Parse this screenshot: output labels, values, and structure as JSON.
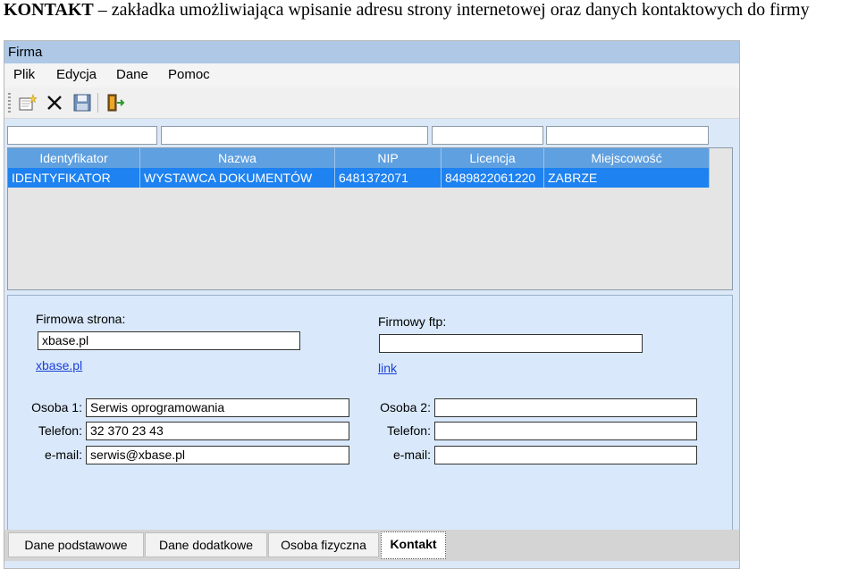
{
  "caption": {
    "bold": "KONTAKT",
    "rest": " – zakładka umożliwiająca wpisanie adresu strony internetowej oraz danych kontaktowych do firmy"
  },
  "window": {
    "title": "Firma"
  },
  "menu": [
    "Plik",
    "Edycja",
    "Dane",
    "Pomoc"
  ],
  "toolbar": {
    "icons": [
      "new-record-icon",
      "delete-icon",
      "save-icon",
      "exit-door-icon"
    ]
  },
  "grid": {
    "columns": [
      "Identyfikator",
      "Nazwa",
      "NIP",
      "Licencja",
      "Miejscowość"
    ],
    "rows": [
      [
        "IDENTYFIKATOR",
        "WYSTAWCA DOKUMENTÓW",
        "6481372071",
        "8489822061220",
        "ZABRZE"
      ]
    ]
  },
  "contact": {
    "website_label": "Firmowa strona:",
    "website_value": "xbase.pl",
    "website_link": "xbase.pl",
    "ftp_label": "Firmowy ftp:",
    "ftp_value": "",
    "ftp_link": "link",
    "person1_label": "Osoba 1:",
    "person1_value": "Serwis oprogramowania",
    "phone1_label": "Telefon:",
    "phone1_value": "32 370 23 43",
    "email1_label": "e-mail:",
    "email1_value": "serwis@xbase.pl",
    "person2_label": "Osoba 2:",
    "person2_value": "",
    "phone2_label": "Telefon:",
    "phone2_value": "",
    "email2_label": "e-mail:",
    "email2_value": ""
  },
  "tabs": [
    "Dane podstawowe",
    "Dane dodatkowe",
    "Osoba fizyczna",
    "Kontakt"
  ],
  "active_tab": "Kontakt",
  "colors": {
    "title_bar": "#aec8e6",
    "header_row": "#5fa0e0",
    "selected_row": "#1e82f0",
    "panel_bg": "#d9e9fb"
  }
}
